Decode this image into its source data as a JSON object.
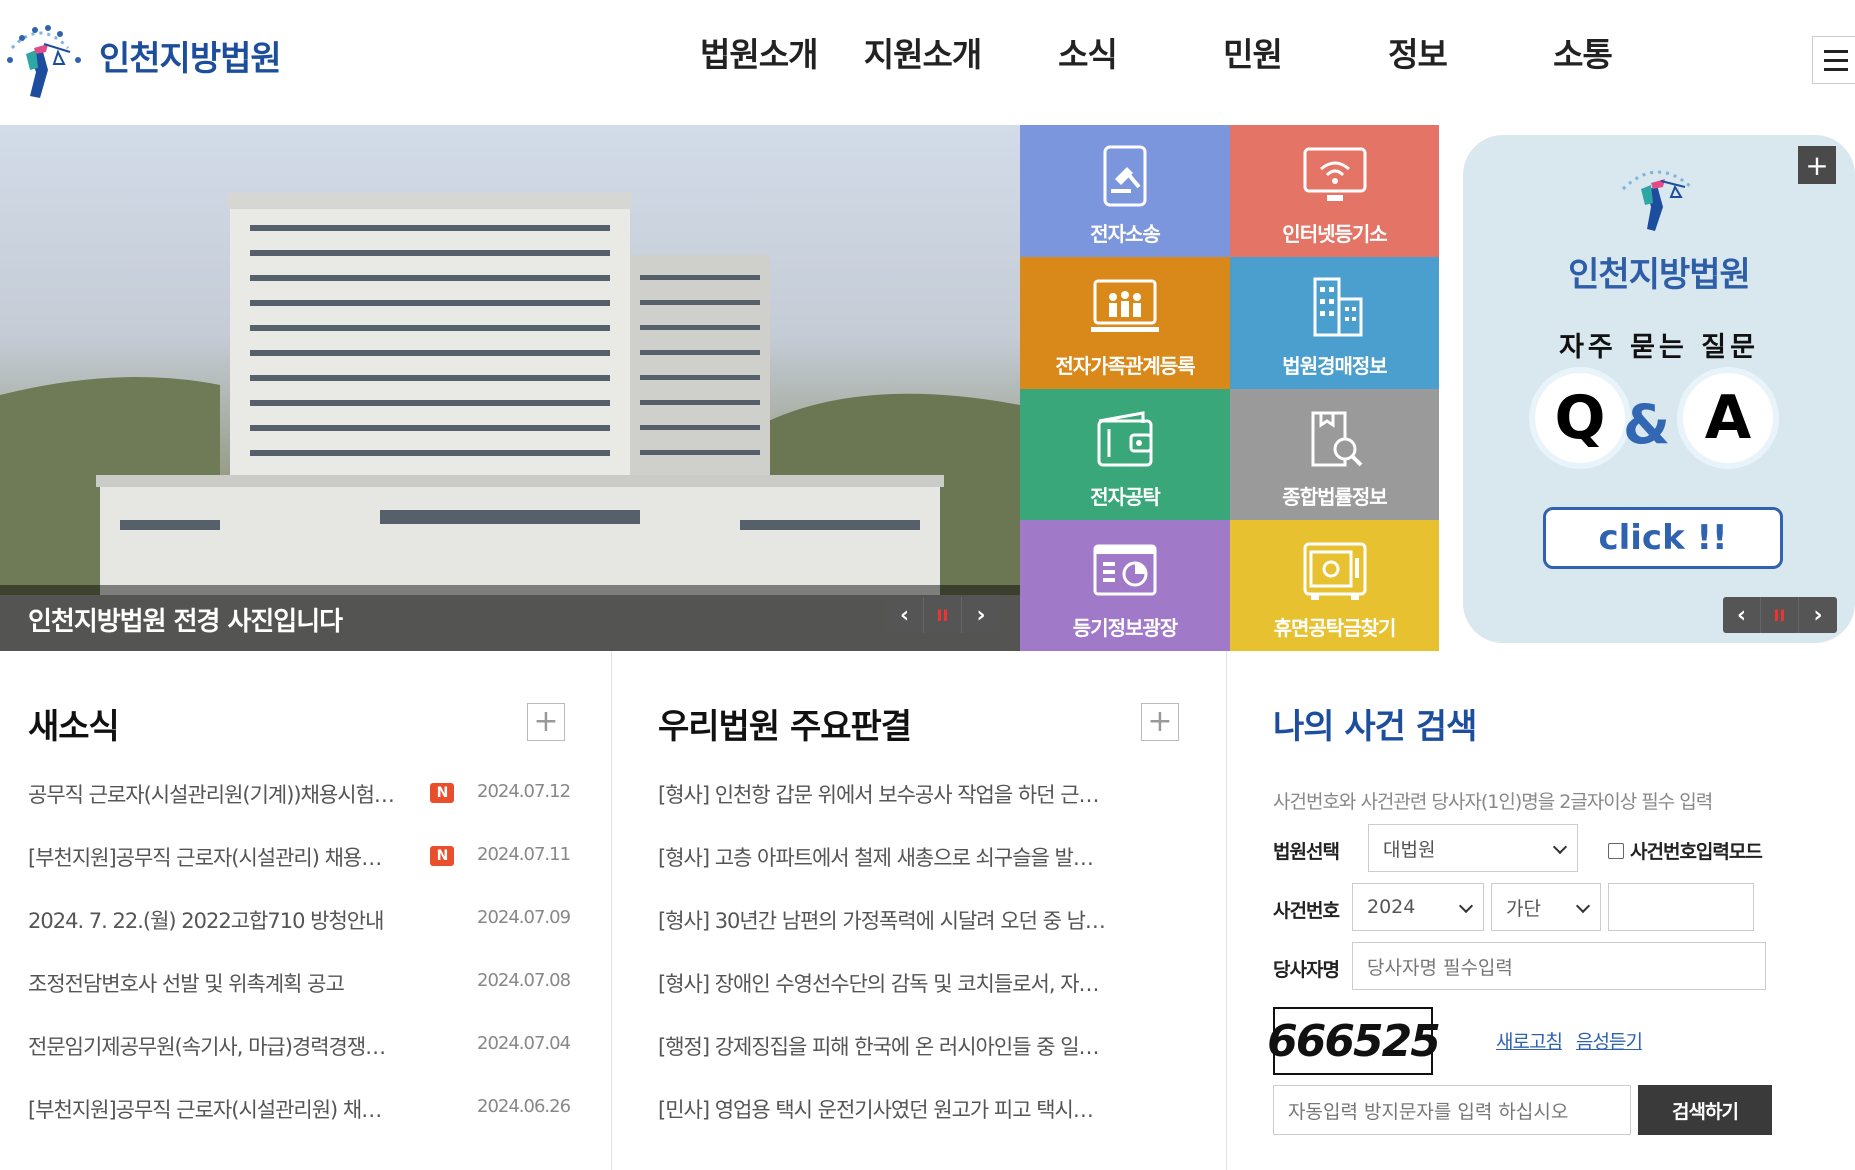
{
  "header": {
    "site_name": "인천지방법원",
    "nav": [
      "법원소개",
      "지원소개",
      "소식",
      "민원",
      "정보",
      "소통"
    ]
  },
  "hero": {
    "caption": "인천지방법원 전경 사진입니다",
    "controls": {
      "prev": "‹",
      "pause": "II",
      "next": "›"
    }
  },
  "quick_links": [
    {
      "label": "전자소송",
      "color": "#7b96dd",
      "icon": "gavel-tablet-icon"
    },
    {
      "label": "인터넷등기소",
      "color": "#e47465",
      "icon": "wifi-monitor-icon"
    },
    {
      "label": "전자가족관계등록",
      "color": "#d9891a",
      "icon": "family-screen-icon"
    },
    {
      "label": "법원경매정보",
      "color": "#4a9fce",
      "icon": "buildings-icon"
    },
    {
      "label": "전자공탁",
      "color": "#3aa77a",
      "icon": "wallet-icon"
    },
    {
      "label": "종합법률정보",
      "color": "#9a9a9a",
      "icon": "book-search-icon"
    },
    {
      "label": "등기정보광장",
      "color": "#a07ac9",
      "icon": "chart-board-icon"
    },
    {
      "label": "휴면공탁금찾기",
      "color": "#e7c12f",
      "icon": "safe-icon"
    }
  ],
  "qa_banner": {
    "court": "인천지방법원",
    "subtitle": "자주 묻는 질문",
    "q": "Q",
    "amp": "&",
    "a": "A",
    "button": "click !!",
    "plus": "+",
    "controls": {
      "prev": "‹",
      "pause": "II",
      "next": "›"
    }
  },
  "news": {
    "title": "새소식",
    "more": "+",
    "new_badge": "N",
    "items": [
      {
        "title": "공무직 근로자(시설관리원(기계))채용시험…",
        "date": "2024.07.12",
        "is_new": true
      },
      {
        "title": "[부천지원]공무직 근로자(시설관리) 채용…",
        "date": "2024.07.11",
        "is_new": true
      },
      {
        "title": "2024. 7. 22.(월) 2022고합710 방청안내",
        "date": "2024.07.09",
        "is_new": false
      },
      {
        "title": "조정전담변호사 선발 및 위촉계획 공고",
        "date": "2024.07.08",
        "is_new": false
      },
      {
        "title": "전문임기제공무원(속기사, 마급)경력경쟁…",
        "date": "2024.07.04",
        "is_new": false
      },
      {
        "title": "[부천지원]공무직 근로자(시설관리원) 채…",
        "date": "2024.06.26",
        "is_new": false
      }
    ]
  },
  "rulings": {
    "title": "우리법원 주요판결",
    "more": "+",
    "items": [
      "[형사] 인천항 갑문 위에서 보수공사 작업을 하던 근…",
      "[형사] 고층 아파트에서 철제 새총으로 쇠구슬을 발…",
      "[형사] 30년간 남편의 가정폭력에 시달려 오던 중 남…",
      "[형사] 장애인 수영선수단의 감독 및 코치들로서, 자…",
      "[행정] 강제징집을 피해 한국에 온 러시아인들 중 일…",
      "[민사] 영업용 택시 운전기사였던 원고가 피고 택시…"
    ]
  },
  "case_search": {
    "title": "나의 사건 검색",
    "hint": "사건번호와 사건관련 당사자(1인)명을 2글자이상 필수 입력",
    "court_label": "법원선택",
    "court_value": "대법원",
    "mode_label": "사건번호입력모드",
    "case_label": "사건번호",
    "year_value": "2024",
    "type_value": "가단",
    "number_value": "",
    "party_label": "당사자명",
    "party_placeholder": "당사자명 필수입력",
    "captcha_text": "666525",
    "refresh_label": "새로고침",
    "audio_label": "음성듣기",
    "captcha_placeholder": "자동입력 방지문자를 입력 하십시오",
    "search_button": "검색하기"
  }
}
